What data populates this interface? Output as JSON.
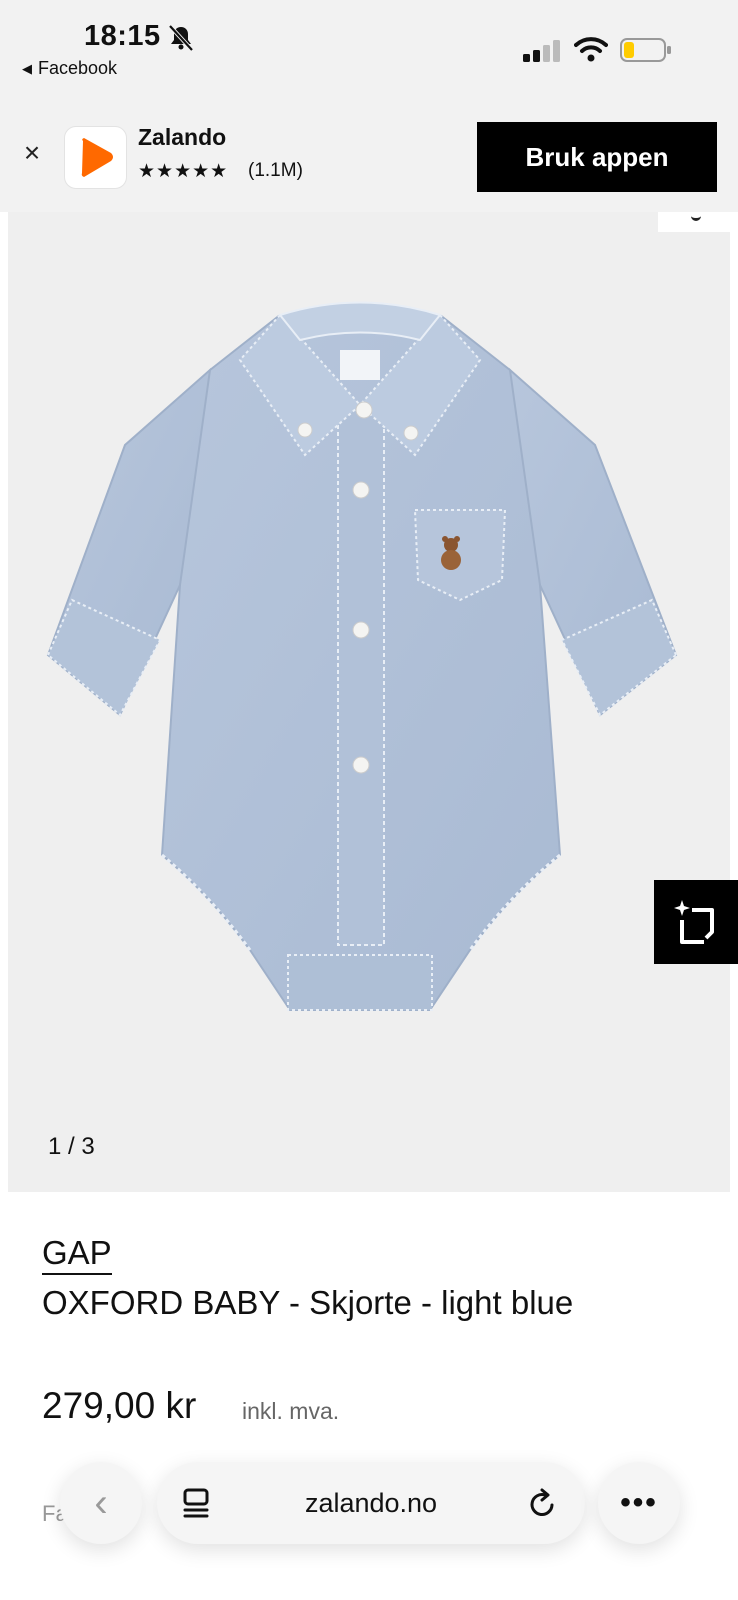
{
  "status_bar": {
    "time": "18:15",
    "back_app": "Facebook",
    "back_arrow": "◀"
  },
  "app_banner": {
    "close_glyph": "×",
    "app_name": "Zalando",
    "stars": "★★★★★",
    "reviews": "(1.1M)",
    "cta_label": "Bruk appen",
    "brand_color": "#ff6900"
  },
  "gallery": {
    "counter": "1 / 3",
    "icons": [
      "bear-logo",
      "similar-items-icon"
    ]
  },
  "product": {
    "brand": "GAP",
    "title": "OXFORD BABY - Skjorte - light blue",
    "price": "279,00 kr",
    "tax_note": "inkl. mva.",
    "partial_text": "Fa      .g."
  },
  "browser": {
    "url": "zalando.no",
    "back_glyph": "‹",
    "more_glyph": "•••"
  }
}
